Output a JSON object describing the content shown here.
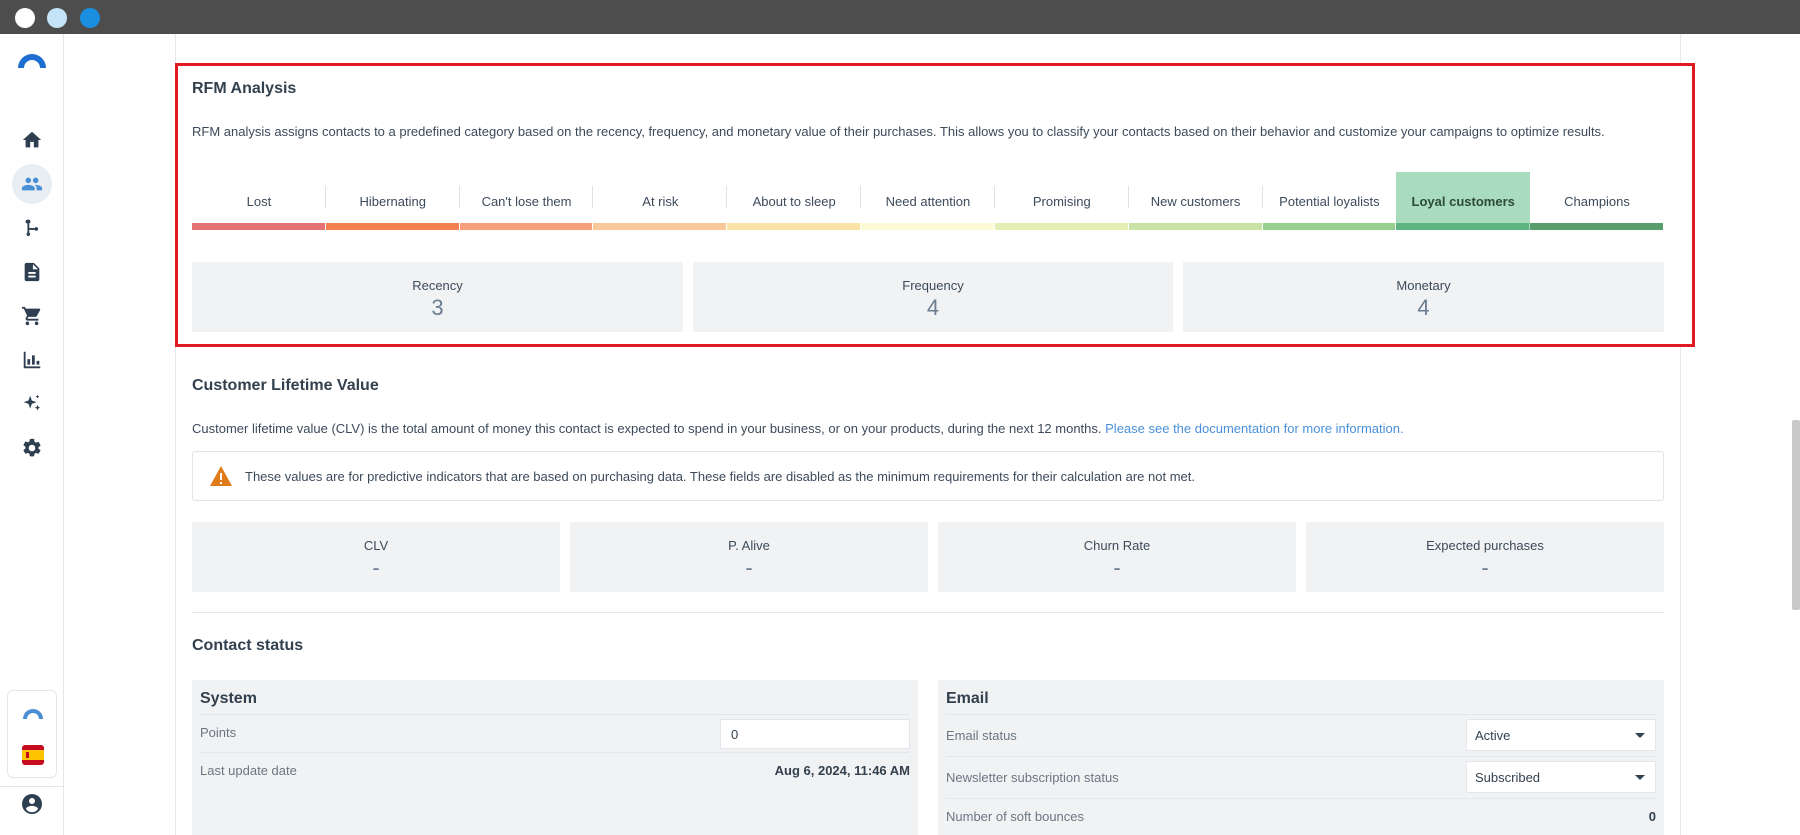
{
  "sidebar": {
    "items": [
      {
        "name": "home-icon"
      },
      {
        "name": "contacts-icon"
      },
      {
        "name": "automation-icon"
      },
      {
        "name": "content-icon"
      },
      {
        "name": "cart-icon"
      },
      {
        "name": "reports-icon"
      },
      {
        "name": "ai-sparkle-icon"
      },
      {
        "name": "settings-icon"
      }
    ],
    "active_index": 1
  },
  "rfm": {
    "title": "RFM Analysis",
    "description": "RFM analysis assigns contacts to a predefined category based on the recency, frequency, and monetary value of their purchases. This allows you to classify your contacts based on their behavior and customize your campaigns to optimize results.",
    "segments": [
      {
        "label": "Lost",
        "color": "#e57373"
      },
      {
        "label": "Hibernating",
        "color": "#f47f4f"
      },
      {
        "label": "Can't lose them",
        "color": "#f5a07a"
      },
      {
        "label": "At risk",
        "color": "#f8c89a"
      },
      {
        "label": "About to sleep",
        "color": "#fbe3a6"
      },
      {
        "label": "Need attention",
        "color": "#fdfbd6"
      },
      {
        "label": "Promising",
        "color": "#e4efb6"
      },
      {
        "label": "New customers",
        "color": "#c8e3a5"
      },
      {
        "label": "Potential loyalists",
        "color": "#96d08e"
      },
      {
        "label": "Loyal customers",
        "color": "#5cb57f"
      },
      {
        "label": "Champions",
        "color": "#5a9e6e"
      }
    ],
    "active_segment": "Loyal customers",
    "recency_label": "Recency",
    "recency_value": "3",
    "frequency_label": "Frequency",
    "frequency_value": "4",
    "monetary_label": "Monetary",
    "monetary_value": "4"
  },
  "clv": {
    "title": "Customer Lifetime Value",
    "description": "Customer lifetime value (CLV) is the total amount of money this contact is expected to spend in your business, or on your products, during the next 12 months.",
    "doc_link": "Please see the documentation for more information.",
    "warning": "These values are for predictive indicators that are based on purchasing data. These fields are disabled as the minimum requirements for their calculation are not met.",
    "clv_label": "CLV",
    "clv_value": "-",
    "alive_label": "P. Alive",
    "alive_value": "-",
    "churn_label": "Churn Rate",
    "churn_value": "-",
    "expected_label": "Expected purchases",
    "expected_value": "-"
  },
  "contact_status": {
    "title": "Contact status",
    "system": {
      "title": "System",
      "points_label": "Points",
      "points_value": "0",
      "last_update_label": "Last update date",
      "last_update_value": "Aug 6, 2024, 11:46 AM"
    },
    "email": {
      "title": "Email",
      "status_label": "Email status",
      "status_value": "Active",
      "newsletter_label": "Newsletter subscription status",
      "newsletter_value": "Subscribed",
      "soft_bounces_label": "Number of soft bounces",
      "soft_bounces_value": "0"
    }
  }
}
